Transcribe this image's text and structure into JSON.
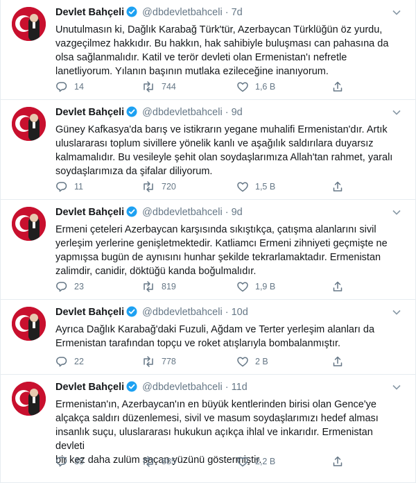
{
  "accent_color": "#1da1f2",
  "tweets": [
    {
      "name": "Devlet Bahçeli",
      "handle": "@dbdevletbahceli",
      "dot": "·",
      "time": "7d",
      "text": "Unutulmasın ki, Dağlık Karabağ Türk'tür, Azerbaycan Türklüğün öz yurdu,\nvazgeçilmez hakkıdır. Bu hakkın, hak sahibiyle buluşması can pahasına da\nolsa sağlanmalıdır. Katil ve terör devleti olan Ermenistan'ı nefretle\nlanetliyorum. Yılanın başının mutlaka ezileceğine inanıyorum.",
      "replies": "14",
      "retweets": "744",
      "likes": "1,6 B"
    },
    {
      "name": "Devlet Bahçeli",
      "handle": "@dbdevletbahceli",
      "dot": "·",
      "time": "9d",
      "text": "Güney Kafkasya'da barış ve istikrarın yegane muhalifi Ermenistan'dır. Artık\nuluslararası toplum sivillere yönelik kanlı ve aşağılık saldırılara duyarsız\nkalmamalıdır. Bu vesileyle şehit olan soydaşlarımıza Allah'tan rahmet, yaralı\nsoydaşlarımıza da şifalar diliyorum.",
      "replies": "11",
      "retweets": "720",
      "likes": "1,5 B"
    },
    {
      "name": "Devlet Bahçeli",
      "handle": "@dbdevletbahceli",
      "dot": "·",
      "time": "9d",
      "text": "Ermeni çeteleri Azerbaycan karşısında sıkıştıkça, çatışma alanlarını sivil\nyerleşim yerlerine genişletmektedir. Katliamcı Ermeni zihniyeti geçmişte ne\nyapmışsa bugün de aynısını hunhar şekilde tekrarlamaktadır. Ermenistan\nzalimdir, canidir, döktüğü kanda boğulmalıdır.",
      "replies": "23",
      "retweets": "819",
      "likes": "1,9 B"
    },
    {
      "name": "Devlet Bahçeli",
      "handle": "@dbdevletbahceli",
      "dot": "·",
      "time": "10d",
      "text": "Ayrıca Dağlık Karabağ'daki Fuzuli, Ağdam ve Terter yerleşim alanları da\nErmenistan tarafından topçu ve roket atışlarıyla bombalanmıştır.",
      "replies": "22",
      "retweets": "778",
      "likes": "2 B"
    },
    {
      "name": "Devlet Bahçeli",
      "handle": "@dbdevletbahceli",
      "dot": "·",
      "time": "11d",
      "text": "Ermenistan'ın, Azerbaycan'ın en büyük kentlerinden birisi olan Gence'ye\nalçakça saldırı düzenlemesi, sivil ve masum soydaşlarımızı hedef alması\ninsanlık suçu, uluslararası hukukun açıkça ihlal ve inkarıdır. Ermenistan devleti\nbir kez daha zulüm saçan yüzünü göstermiştir.",
      "replies": "35",
      "retweets": "885",
      "likes": "2,2 B"
    }
  ]
}
